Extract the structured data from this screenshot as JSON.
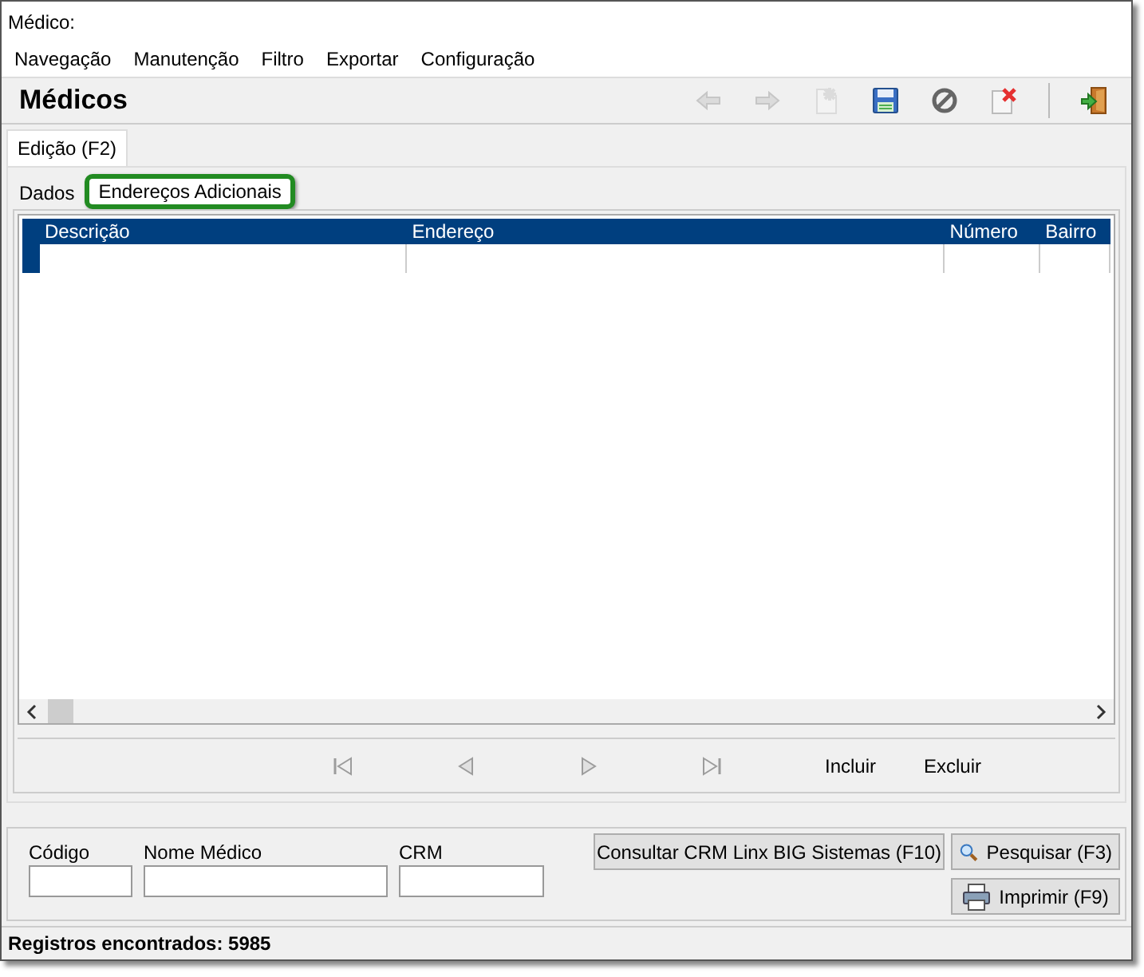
{
  "window": {
    "title": "Médico:"
  },
  "menu": [
    {
      "label": "Navegação"
    },
    {
      "label": "Manutenção"
    },
    {
      "label": "Filtro"
    },
    {
      "label": "Exportar"
    },
    {
      "label": "Configuração"
    }
  ],
  "header": {
    "title": "Médicos"
  },
  "toolbar": [
    {
      "kind": "back",
      "disabled": true
    },
    {
      "kind": "forward",
      "disabled": true
    },
    {
      "kind": "new",
      "disabled": true
    },
    {
      "kind": "save",
      "disabled": false
    },
    {
      "kind": "cancel",
      "disabled": false
    },
    {
      "kind": "delete",
      "disabled": false
    },
    {
      "kind": "separator"
    },
    {
      "kind": "exit",
      "disabled": false
    }
  ],
  "main_tabs": [
    {
      "label": "Edição (F2)",
      "selected": true
    }
  ],
  "sub_tabs": [
    {
      "label": "Dados",
      "selected": false,
      "highlighted": false
    },
    {
      "label": "Endereços Adicionais",
      "selected": true,
      "highlighted": true
    }
  ],
  "table": {
    "columns": [
      {
        "label": "Descrição"
      },
      {
        "label": "Endereço"
      },
      {
        "label": "Número"
      },
      {
        "label": "Bairro"
      }
    ]
  },
  "navigator": [
    {
      "kind": "first",
      "disabled": true
    },
    {
      "kind": "prior",
      "disabled": true
    },
    {
      "kind": "next",
      "disabled": true
    },
    {
      "kind": "last",
      "disabled": true
    },
    {
      "kind": "text",
      "label": "Incluir"
    },
    {
      "kind": "text",
      "label": "Excluir"
    }
  ],
  "search": {
    "fields": [
      {
        "label": "Código"
      },
      {
        "label": "Nome Médico"
      },
      {
        "label": "CRM"
      }
    ],
    "buttons": [
      {
        "kind": "plain",
        "label": "Consultar CRM Linx BIG Sistemas (F10)"
      },
      {
        "kind": "search",
        "label": "Pesquisar (F3)"
      },
      {
        "kind": "print",
        "label": "Imprimir (F9)"
      }
    ]
  },
  "status_bar": {
    "text": "Registros encontrados: 5985"
  }
}
